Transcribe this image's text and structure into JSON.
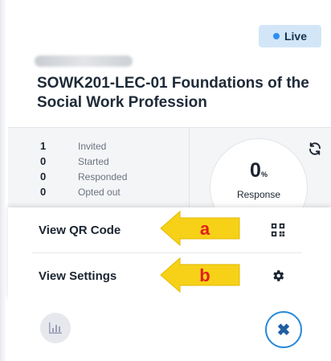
{
  "header": {
    "status_badge": "Live",
    "course_title": "SOWK201-LEC-01 Foundations of the Social Work Profession"
  },
  "stats": [
    {
      "value": "1",
      "label": "Invited"
    },
    {
      "value": "0",
      "label": "Started"
    },
    {
      "value": "0",
      "label": "Responded"
    },
    {
      "value": "0",
      "label": "Opted out"
    }
  ],
  "gauge": {
    "value": "0",
    "unit": "%",
    "label": "Response"
  },
  "menu": {
    "items": [
      {
        "label": "View QR Code",
        "icon": "qr-code-icon",
        "annotation": "a"
      },
      {
        "label": "View Settings",
        "icon": "gear-icon",
        "annotation": "b"
      }
    ]
  },
  "actions": {
    "close_symbol": "✖"
  },
  "colors": {
    "accent": "#2c8ad8",
    "badge_bg": "#d3e6f7",
    "callout": "#f7d117",
    "callout_text": "#e11f1f"
  }
}
